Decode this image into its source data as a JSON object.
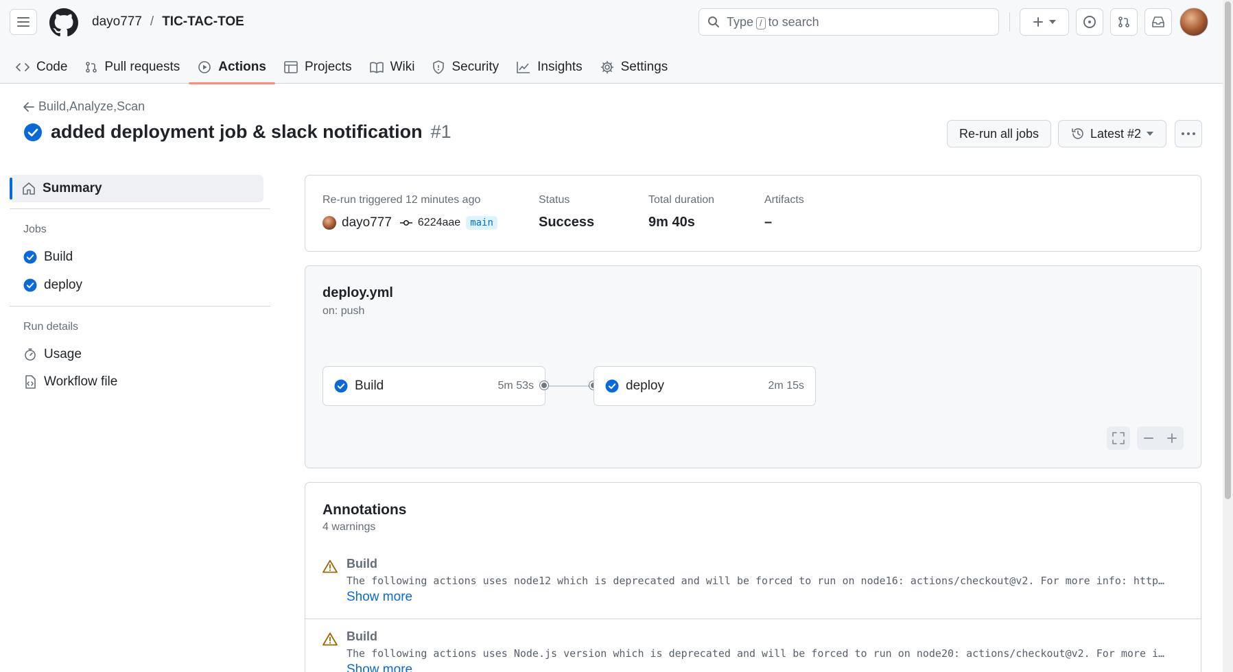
{
  "header": {
    "owner": "dayo777",
    "separator": "/",
    "repo": "TIC-TAC-TOE",
    "search": {
      "prefix": "Type",
      "key": "/",
      "suffix": "to search"
    }
  },
  "tabs": [
    {
      "label": "Code",
      "icon": "code-icon"
    },
    {
      "label": "Pull requests",
      "icon": "pull-request-icon"
    },
    {
      "label": "Actions",
      "icon": "play-icon",
      "active": true
    },
    {
      "label": "Projects",
      "icon": "table-icon"
    },
    {
      "label": "Wiki",
      "icon": "book-icon"
    },
    {
      "label": "Security",
      "icon": "shield-icon"
    },
    {
      "label": "Insights",
      "icon": "graph-icon"
    },
    {
      "label": "Settings",
      "icon": "gear-icon"
    }
  ],
  "run": {
    "back_label": "Build,Analyze,Scan",
    "title": "added deployment job & slack notification",
    "number": "#1",
    "rerun_label": "Re-run all jobs",
    "attempt_label": "Latest #2"
  },
  "sidebar": {
    "summary_label": "Summary",
    "jobs_heading": "Jobs",
    "jobs": [
      "Build",
      "deploy"
    ],
    "run_details_heading": "Run details",
    "usage_label": "Usage",
    "workflow_file_label": "Workflow file"
  },
  "summary": {
    "trigger_label": "Re-run triggered",
    "trigger_time": "12 minutes ago",
    "actor": "dayo777",
    "commit": "6224aae",
    "branch": "main",
    "status_label": "Status",
    "status_value": "Success",
    "duration_label": "Total duration",
    "duration_value": "9m 40s",
    "artifacts_label": "Artifacts",
    "artifacts_value": "–"
  },
  "workflow": {
    "file": "deploy.yml",
    "trigger": "on: push",
    "jobs": [
      {
        "name": "Build",
        "duration": "5m 53s"
      },
      {
        "name": "deploy",
        "duration": "2m 15s"
      }
    ]
  },
  "annotations": {
    "title": "Annotations",
    "count": "4 warnings",
    "items": [
      {
        "job": "Build",
        "message": "The following actions uses node12 which is deprecated and will be forced to run on node16: actions/checkout@v2. For more info: https://github.blog/changelog/",
        "more": "Show more"
      },
      {
        "job": "Build",
        "message": "The following actions uses Node.js version which is deprecated and will be forced to run on node20: actions/checkout@v2. For more info: https://github.blog/changelog/",
        "more": "Show more"
      }
    ]
  },
  "colors": {
    "success": "#0969da",
    "accent_underline": "#fd8c73",
    "warning": "#9a6700",
    "link": "#0969da"
  }
}
